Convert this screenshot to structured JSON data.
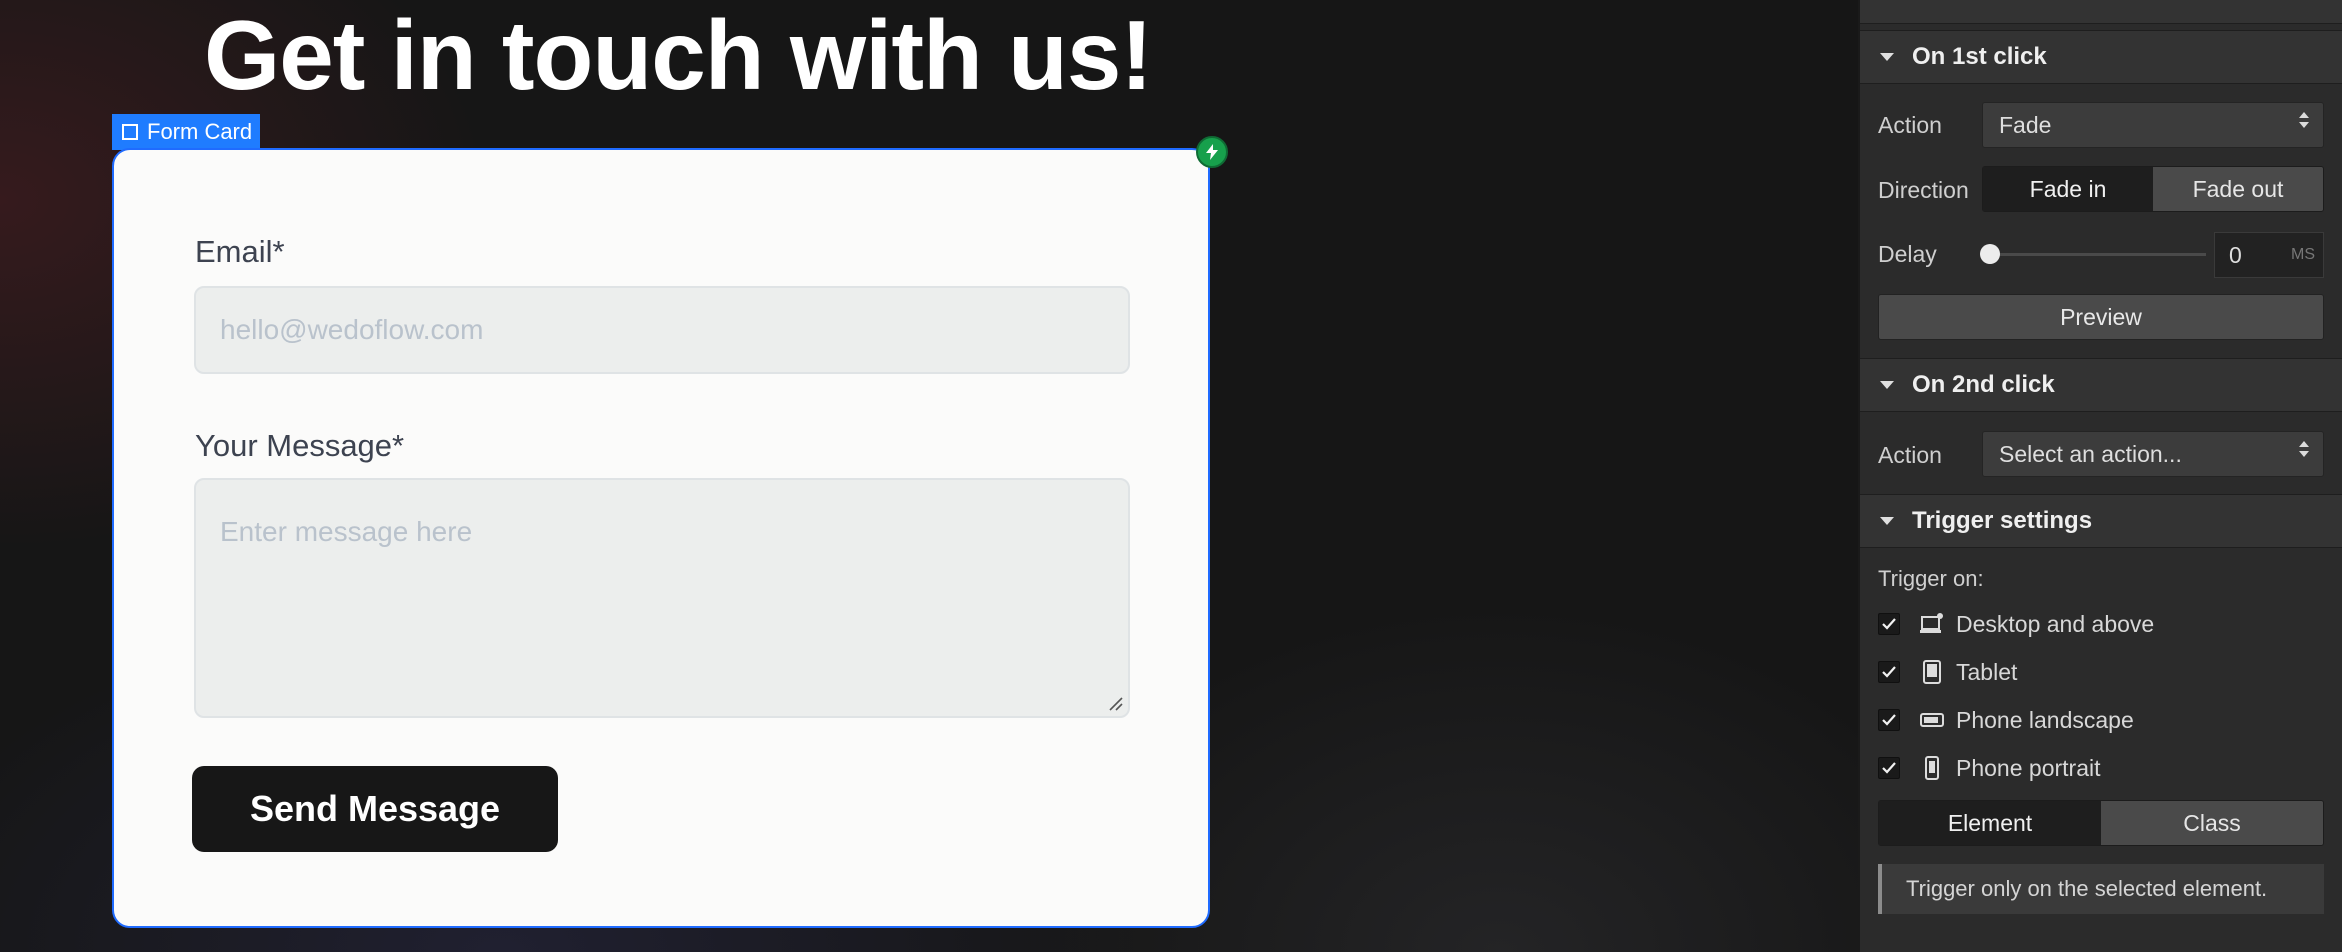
{
  "canvas": {
    "hero_title": "Get in touch with us!",
    "selection_label": "Form Card",
    "form": {
      "email_label": "Email*",
      "email_placeholder": "hello@wedoflow.com",
      "message_label": "Your Message*",
      "message_placeholder": "Enter message here",
      "submit_label": "Send Message"
    }
  },
  "panel": {
    "first_click": {
      "title": "On 1st click",
      "action_label": "Action",
      "action_value": "Fade",
      "direction_label": "Direction",
      "direction_options": [
        "Fade in",
        "Fade out"
      ],
      "direction_selected": "Fade in",
      "delay_label": "Delay",
      "delay_value": "0",
      "delay_unit": "MS",
      "preview_label": "Preview"
    },
    "second_click": {
      "title": "On 2nd click",
      "action_label": "Action",
      "action_value": "Select an action..."
    },
    "trigger_settings": {
      "title": "Trigger settings",
      "trigger_on_label": "Trigger on:",
      "devices": [
        {
          "label": "Desktop and above",
          "icon": "desktop-icon",
          "checked": true
        },
        {
          "label": "Tablet",
          "icon": "tablet-icon",
          "checked": true
        },
        {
          "label": "Phone landscape",
          "icon": "phone-landscape-icon",
          "checked": true
        },
        {
          "label": "Phone portrait",
          "icon": "phone-portrait-icon",
          "checked": true
        }
      ],
      "scope_options": [
        "Element",
        "Class"
      ],
      "scope_selected": "Element",
      "info_text": "Trigger only on the selected element."
    }
  },
  "colors": {
    "selection_blue": "#1f7cff",
    "interaction_badge_green": "#17a04c",
    "panel_bg": "#2b2b2b"
  }
}
